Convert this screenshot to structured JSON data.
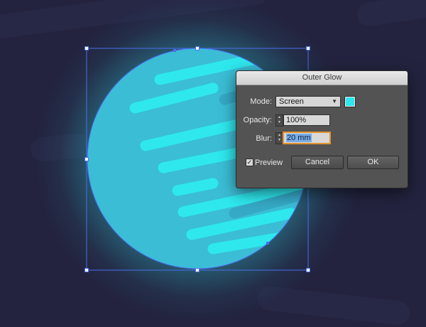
{
  "canvas": {
    "background": "#23233f",
    "planet_color": "#3bbdd6",
    "glow_color": "#2ee8ee",
    "stripe_color": "#2ee8ee",
    "selection_color": "#4a6ef0"
  },
  "dialog": {
    "title": "Outer Glow",
    "mode_label": "Mode:",
    "mode_value": "Screen",
    "color_swatch": "#2ee8ee",
    "opacity_label": "Opacity:",
    "opacity_value": "100%",
    "blur_label": "Blur:",
    "blur_value": "20 mm",
    "preview_label": "Preview",
    "preview_checked": true,
    "cancel_label": "Cancel",
    "ok_label": "OK"
  }
}
